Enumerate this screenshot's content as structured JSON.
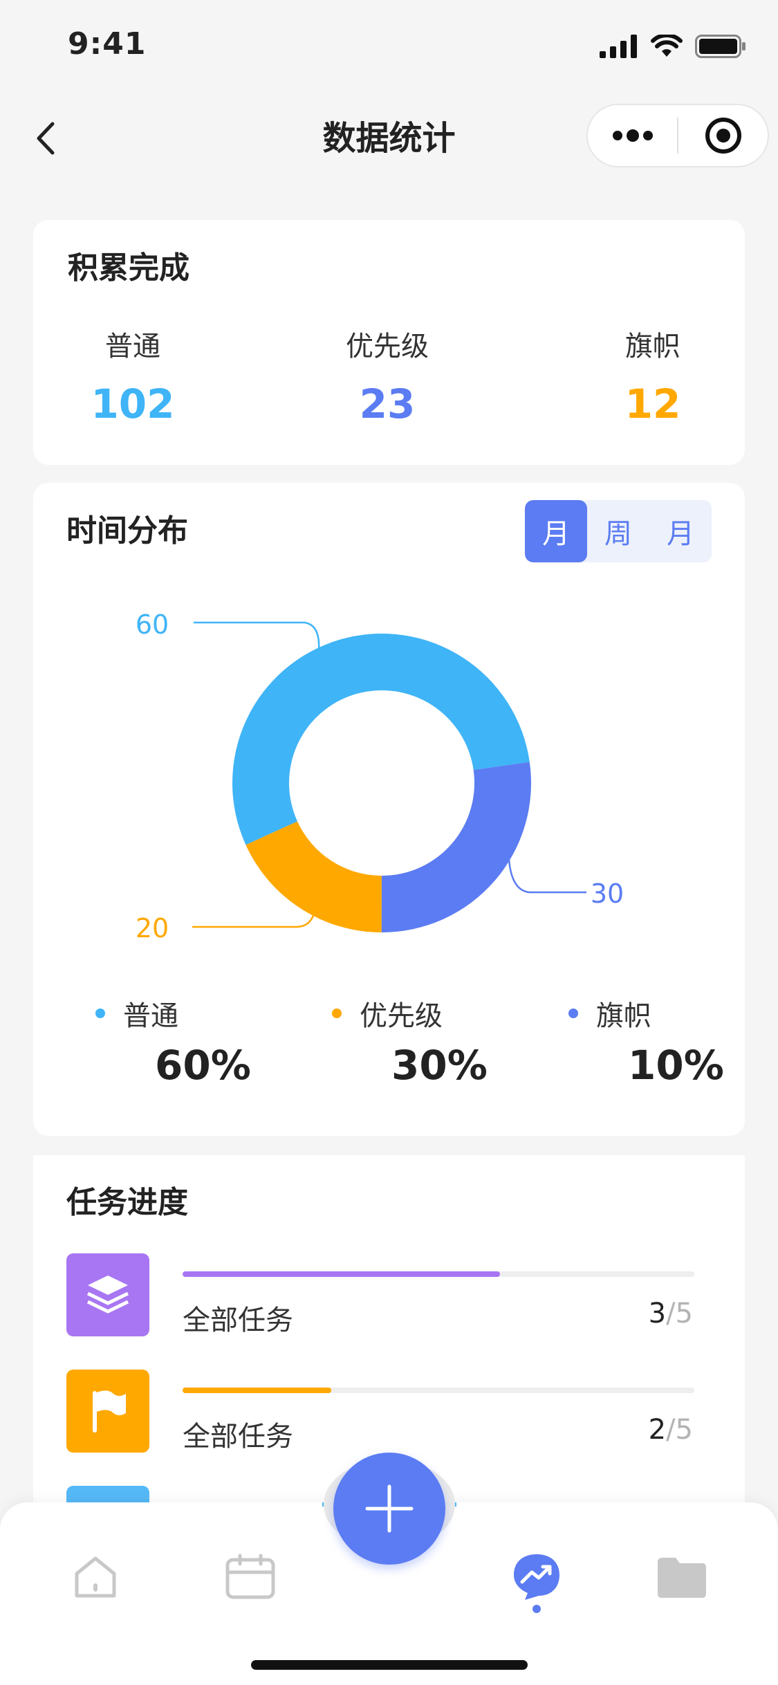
{
  "status": {
    "time": "9:41"
  },
  "nav": {
    "title": "数据统计"
  },
  "accumulated": {
    "title": "积累完成",
    "items": [
      {
        "label": "普通",
        "value": "102",
        "color": "#3fb4f7"
      },
      {
        "label": "优先级",
        "value": "23",
        "color": "#5b7cf2"
      },
      {
        "label": "旗帜",
        "value": "12",
        "color": "#ffa800"
      }
    ]
  },
  "distribution": {
    "title": "时间分布",
    "segments": [
      {
        "label": "月",
        "active": true
      },
      {
        "label": "周",
        "active": false
      },
      {
        "label": "月",
        "active": false
      }
    ],
    "chart_data": {
      "type": "pie",
      "categories": [
        "普通",
        "优先级",
        "旗帜"
      ],
      "values": [
        60,
        30,
        20
      ],
      "colors": [
        "#3fb4f7",
        "#5b7cf2",
        "#ffa800"
      ]
    },
    "legend": [
      {
        "label": "普通",
        "pct": "60%",
        "color": "#3fb4f7"
      },
      {
        "label": "优先级",
        "pct": "30%",
        "color": "#ffa800"
      },
      {
        "label": "旗帜",
        "pct": "10%",
        "color": "#5b7cf2"
      }
    ]
  },
  "progress": {
    "title": "任务进度",
    "tasks": [
      {
        "name": "全部任务",
        "done": "3",
        "total": "/5",
        "fraction": 0.62,
        "color": "#a876f2",
        "icon": "layers-icon"
      },
      {
        "name": "全部任务",
        "done": "2",
        "total": "/5",
        "fraction": 0.29,
        "color": "#ffa800",
        "icon": "flag-icon"
      }
    ],
    "partial_icon_color": "#56b9f7"
  },
  "tabbar": {
    "tabs": [
      "home-icon",
      "calendar-icon",
      "add-icon",
      "trend-icon",
      "folder-icon"
    ],
    "active_color": "#5b7cf2",
    "inactive_color": "#c8c8c8"
  }
}
